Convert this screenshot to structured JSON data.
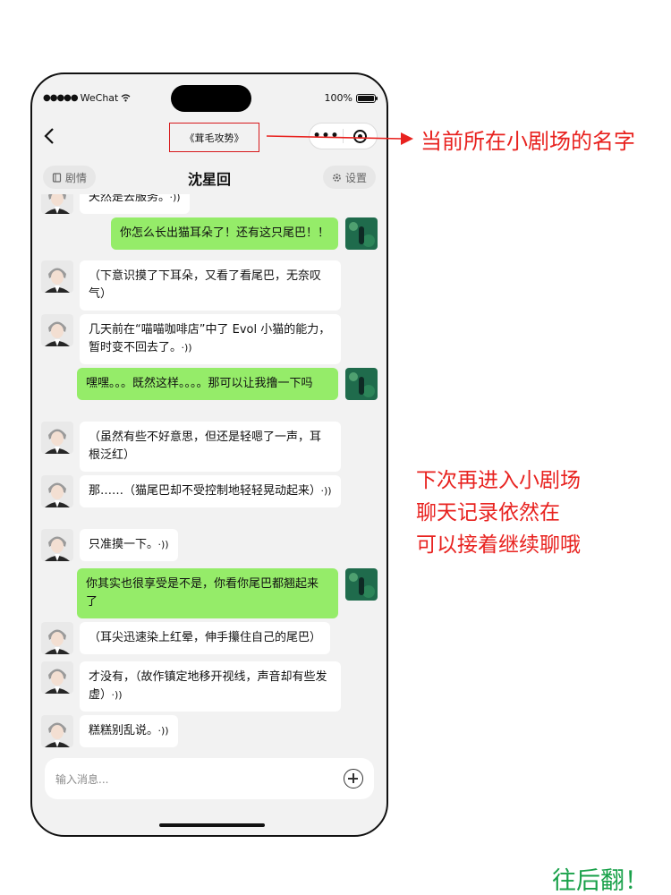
{
  "status_bar": {
    "carrier": "WeChat",
    "signal_dots": "●●●●●",
    "battery": "100%",
    "battery_level": 1.0
  },
  "nav": {
    "back_icon": "‹",
    "theater_title": "《茸毛攻势》",
    "more_icon": "•••"
  },
  "header": {
    "plot_label": "剧情",
    "character_name": "沈星回",
    "settings_label": "设置"
  },
  "messages": [
    {
      "side": "left",
      "text": "夫然是去服务。",
      "voice": true
    },
    {
      "side": "right",
      "text": "你怎么长出猫耳朵了！还有这只尾巴！！",
      "voice": false
    },
    {
      "side": "left",
      "text": "（下意识摸了下耳朵，又看了看尾巴，无奈叹气）",
      "voice": false
    },
    {
      "side": "left",
      "text": "几天前在“喵喵咖啡店”中了 Evol 小猫的能力，暂时变不回去了。",
      "voice": true
    },
    {
      "side": "right",
      "text": "嘿嘿。。。既然这样。。。。那可以让我撸一下吗",
      "voice": false
    },
    {
      "side": "left",
      "text": "（虽然有些不好意思，但还是轻嗯了一声，耳根泛红）",
      "voice": false
    },
    {
      "side": "left",
      "text": "那……（猫尾巴却不受控制地轻轻晃动起来）",
      "voice": true
    },
    {
      "side": "left",
      "text": "只准摸一下。",
      "voice": true
    },
    {
      "side": "right",
      "text": "你其实也很享受是不是，你看你尾巴都翘起来了",
      "voice": false
    },
    {
      "side": "left",
      "text": "（耳尖迅速染上红晕，伸手攥住自己的尾巴）",
      "voice": false
    },
    {
      "side": "left",
      "text": "才没有，（故作镇定地移开视线，声音却有些发虚）",
      "voice": true
    },
    {
      "side": "left",
      "text": "糕糕别乱说。",
      "voice": true
    }
  ],
  "input": {
    "placeholder": "输入消息..."
  },
  "annotations": {
    "title_note": "当前所在小剧场的名字",
    "history_note": [
      "下次再进入小剧场",
      "聊天记录依然在",
      "可以接着继续聊哦"
    ],
    "next_note": "往后翻！"
  },
  "colors": {
    "annotation_red": "#e8221f",
    "annotation_green": "#19a14a",
    "bubble_green": "#95ec69"
  }
}
